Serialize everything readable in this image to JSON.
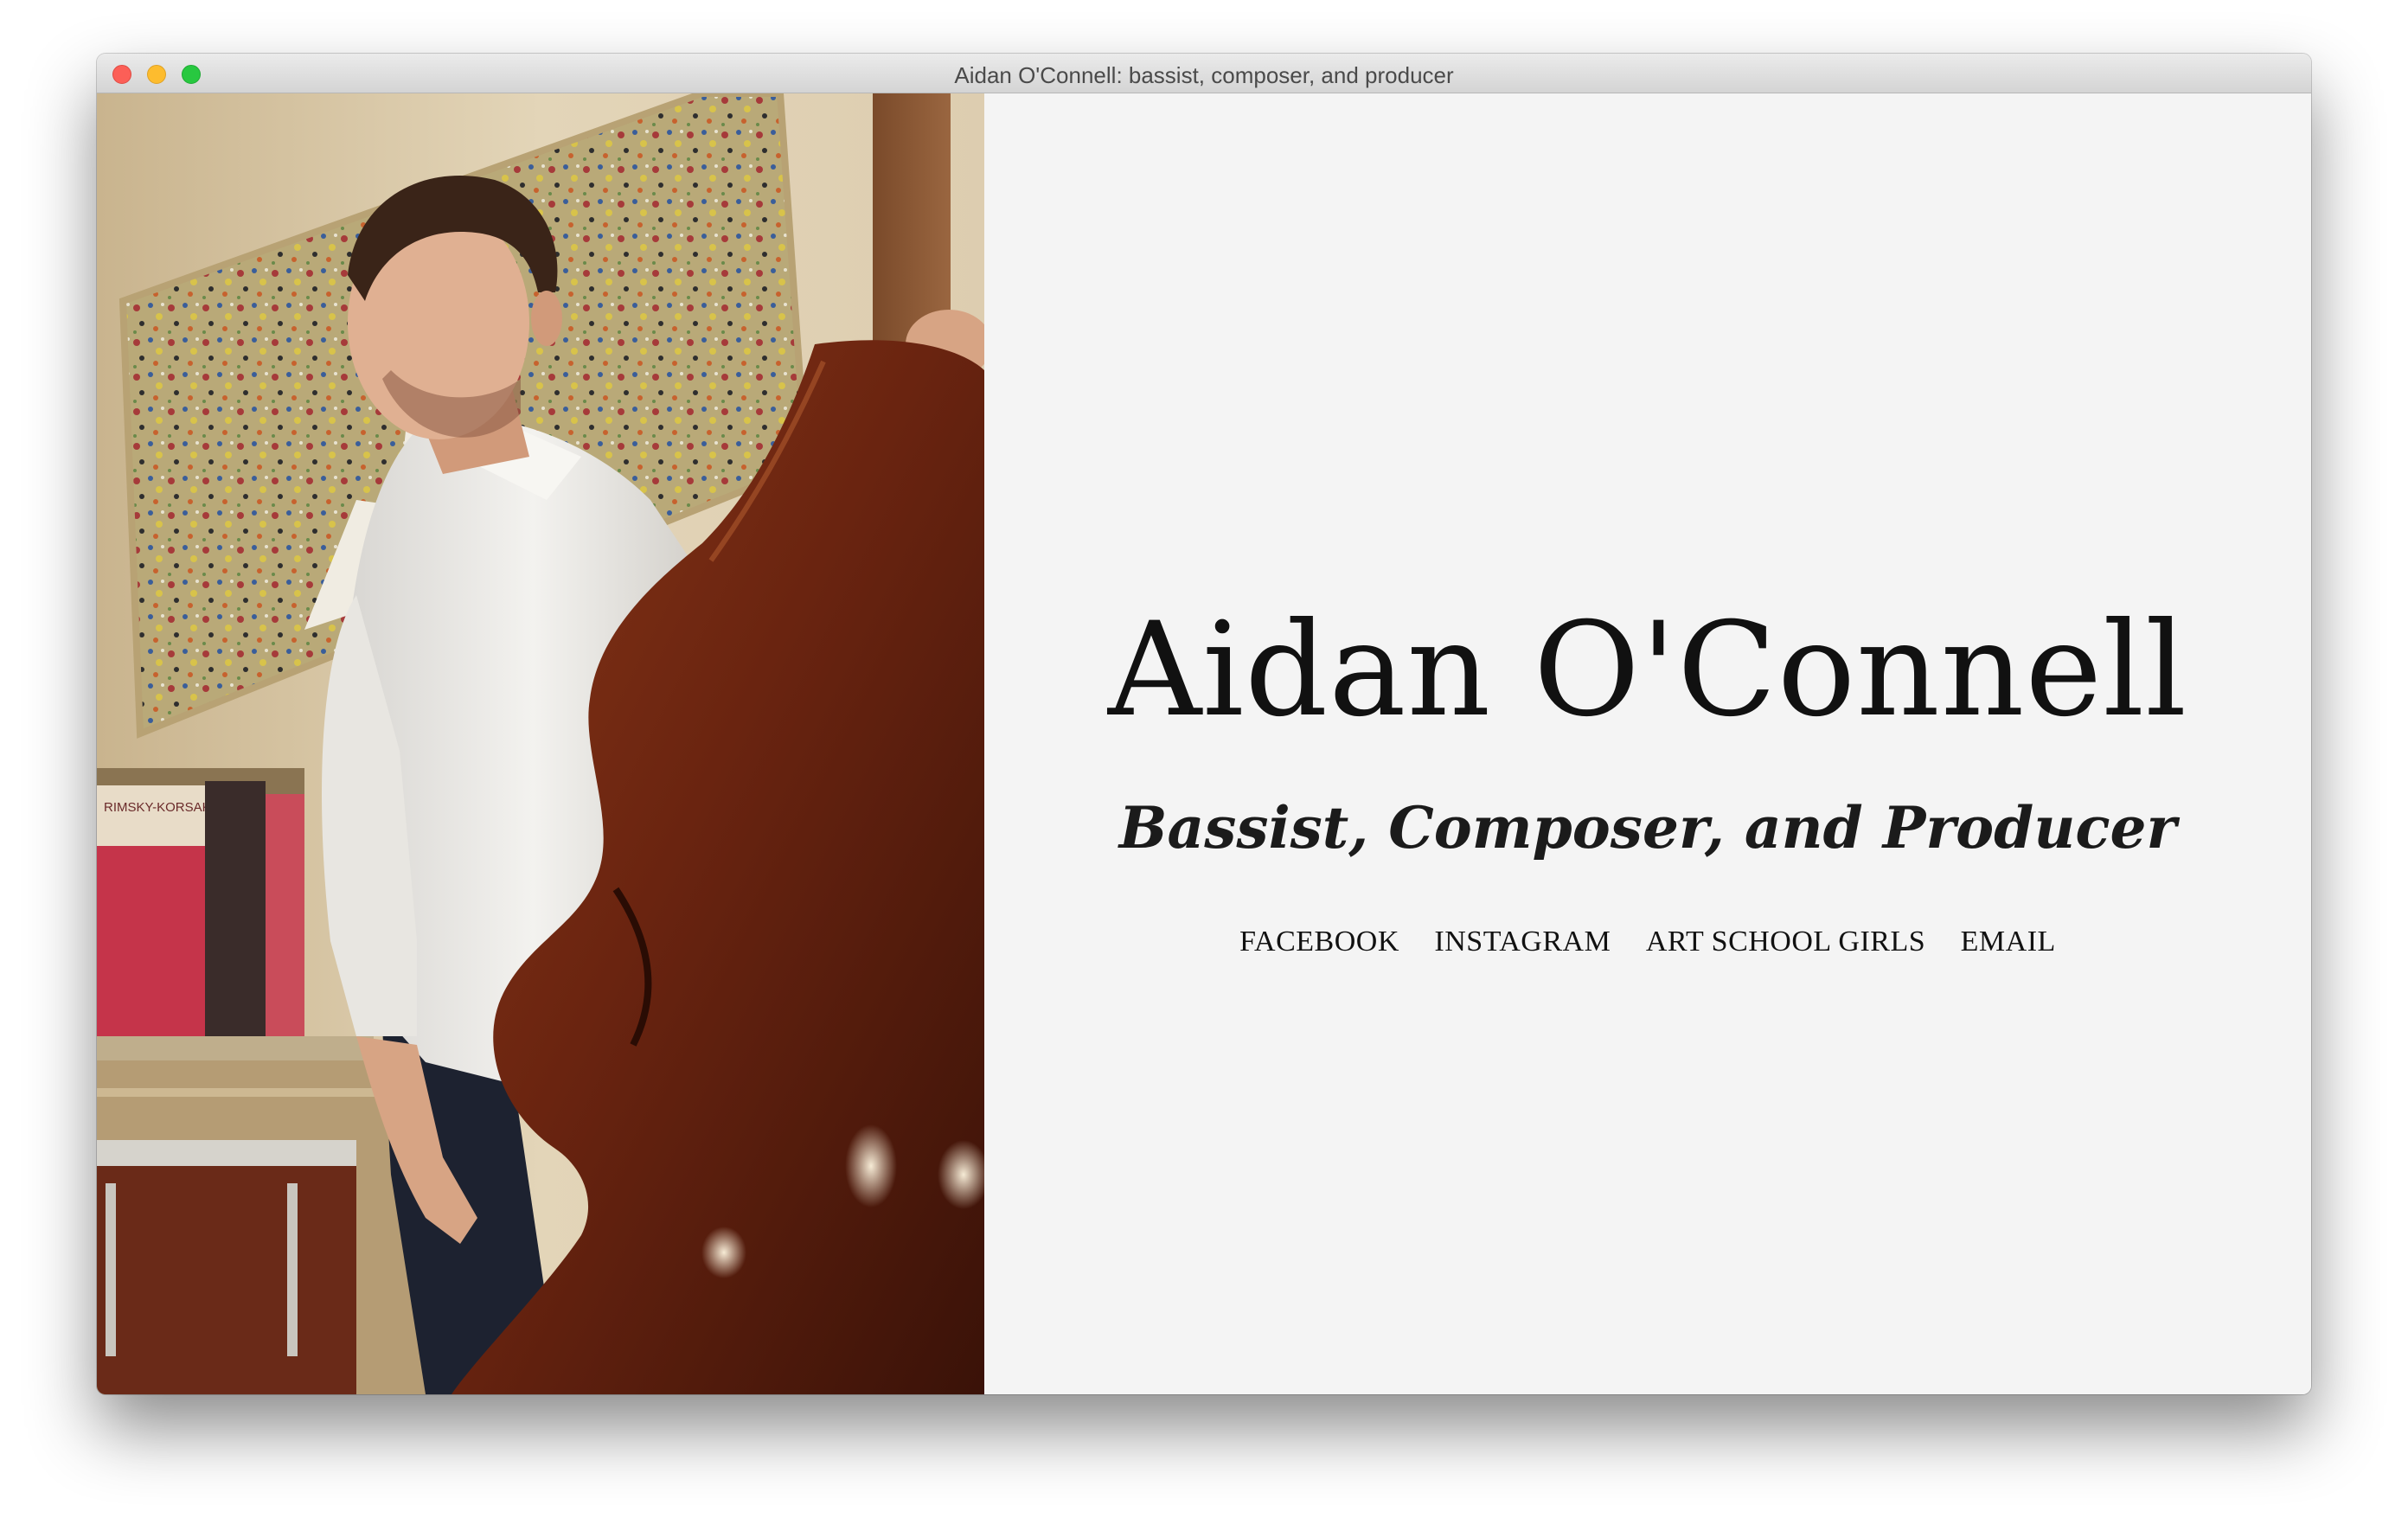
{
  "window": {
    "title": "Aidan O'Connell: bassist, composer, and producer"
  },
  "hero": {
    "name": "Aidan O'Connell",
    "tagline": "Bassist, Composer, and Producer"
  },
  "nav": {
    "links": [
      "FACEBOOK",
      "INSTAGRAM",
      "ART SCHOOL GIRLS",
      "EMAIL"
    ]
  },
  "photo": {
    "book_title": "RIMSKY-KORSAKOV"
  },
  "colors": {
    "background": "#f4f4f4",
    "text": "#111111",
    "bass_wood": "#6a2410"
  },
  "icons": [
    "close-window-icon",
    "minimize-window-icon",
    "maximize-window-icon"
  ]
}
